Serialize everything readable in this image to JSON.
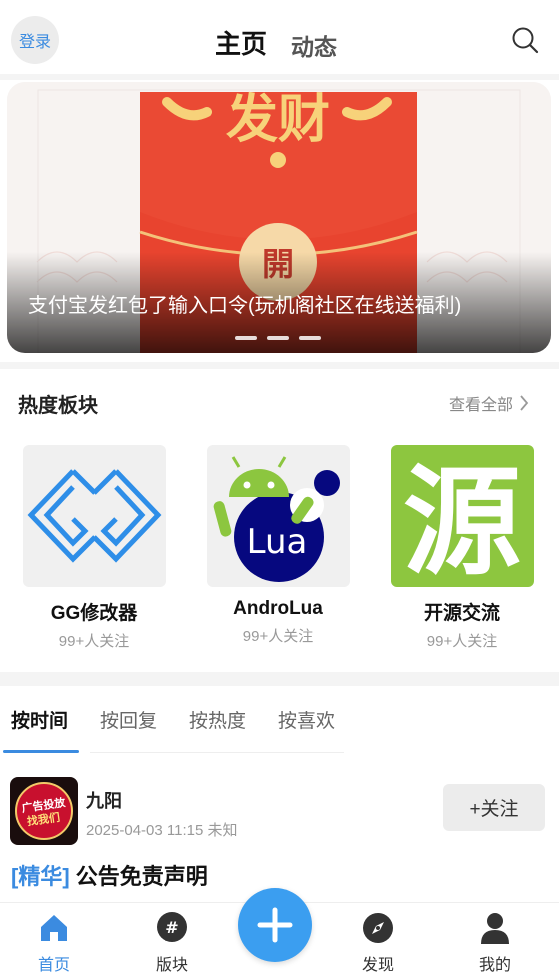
{
  "header": {
    "login_label": "登录",
    "tab_main": "主页",
    "tab_feed": "动态"
  },
  "banner": {
    "caption": "支付宝发红包了输入口令(玩机阁社区在线送福利)",
    "envelope_top_text": "发财",
    "envelope_seal_text": "開",
    "slide_count": 3
  },
  "hot_section": {
    "title": "热度板块",
    "view_all": "查看全部",
    "boards": [
      {
        "name": "GG修改器",
        "followers": "99+人关注"
      },
      {
        "name": "AndroLua",
        "followers": "99+人关注",
        "logo_text": "Lua"
      },
      {
        "name": "开源交流",
        "followers": "99+人关注",
        "logo_text": "源"
      }
    ]
  },
  "sort_tabs": [
    "按时间",
    "按回复",
    "按热度",
    "按喜欢"
  ],
  "post": {
    "username": "九阳",
    "meta": "2025-04-03 11:15 未知",
    "follow_label": "+关注",
    "tag": "[精华]",
    "title": "公告免责声明",
    "avatar_text_line1": "广告投放",
    "avatar_text_line2": "找我们"
  },
  "bottom_nav": {
    "home": "首页",
    "boards": "版块",
    "discover": "发现",
    "mine": "我的"
  },
  "colors": {
    "accent": "#3b8be0",
    "fab": "#3b9ef0",
    "envelope_red": "#e8442f",
    "source_green": "#8dc63f",
    "lua_navy": "#06087f"
  }
}
